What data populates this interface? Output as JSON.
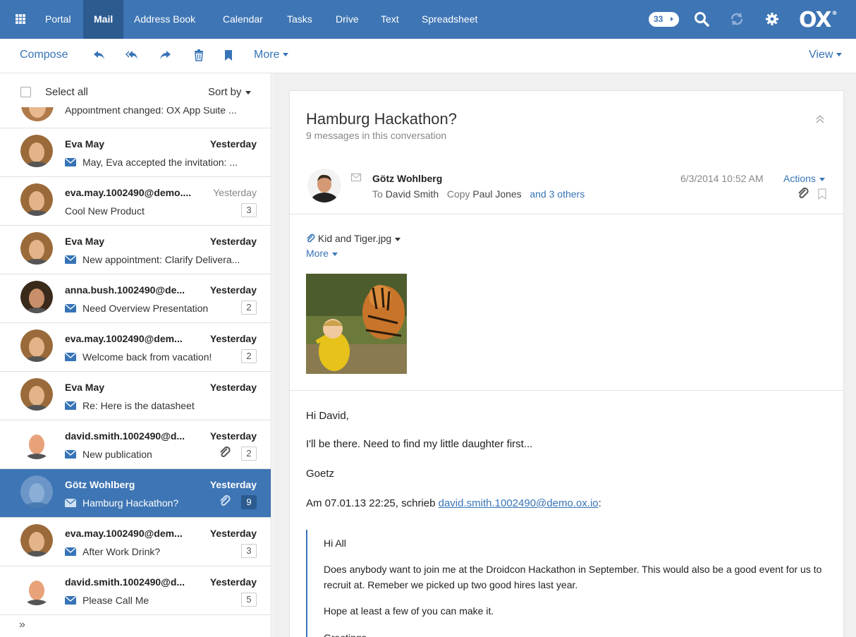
{
  "topbar": {
    "tabs": [
      {
        "label": "Portal",
        "active": false
      },
      {
        "label": "Mail",
        "active": true
      },
      {
        "label": "Address Book",
        "active": false
      },
      {
        "label": "Calendar",
        "active": false
      },
      {
        "label": "Tasks",
        "active": false
      },
      {
        "label": "Drive",
        "active": false
      },
      {
        "label": "Text",
        "active": false
      },
      {
        "label": "Spreadsheet",
        "active": false
      }
    ],
    "notification_count": "33",
    "logo": "OX",
    "accent_color": "#3e75b4",
    "icons": [
      "apps-grid-icon",
      "search-icon",
      "refresh-icon",
      "gear-icon"
    ]
  },
  "toolbar": {
    "compose": "Compose",
    "more": "More",
    "view": "View",
    "icons": [
      "reply-icon",
      "reply-all-icon",
      "forward-icon",
      "delete-icon",
      "flag-icon"
    ]
  },
  "list": {
    "select_all": "Select all",
    "sort_by": "Sort by",
    "partial_subject": "Appointment changed: OX App Suite ...",
    "items": [
      {
        "from": "Eva May",
        "date": "Yesterday",
        "subject": "May, Eva accepted the invitation: ...",
        "count": "",
        "unread": true,
        "attachment": false
      },
      {
        "from": "eva.may.1002490@demo....",
        "date": "Yesterday",
        "subject": "Cool New Product",
        "count": "3",
        "unread": false,
        "attachment": false
      },
      {
        "from": "Eva May",
        "date": "Yesterday",
        "subject": "New appointment: Clarify Delivera...",
        "count": "",
        "unread": true,
        "attachment": false
      },
      {
        "from": "anna.bush.1002490@de...",
        "date": "Yesterday",
        "subject": "Need Overview Presentation",
        "count": "2",
        "unread": true,
        "attachment": false
      },
      {
        "from": "eva.may.1002490@dem...",
        "date": "Yesterday",
        "subject": "Welcome back from vacation!",
        "count": "2",
        "unread": true,
        "attachment": false
      },
      {
        "from": "Eva May",
        "date": "Yesterday",
        "subject": "Re: Here is the datasheet",
        "count": "",
        "unread": true,
        "attachment": false
      },
      {
        "from": "david.smith.1002490@d...",
        "date": "Yesterday",
        "subject": "New publication",
        "count": "2",
        "unread": true,
        "attachment": true
      },
      {
        "from": "Götz Wohlberg",
        "date": "Yesterday",
        "subject": "Hamburg Hackathon?",
        "count": "9",
        "unread": true,
        "attachment": true,
        "selected": true
      },
      {
        "from": "eva.may.1002490@dem...",
        "date": "Yesterday",
        "subject": "After Work Drink?",
        "count": "3",
        "unread": true,
        "attachment": false
      },
      {
        "from": "david.smith.1002490@d...",
        "date": "Yesterday",
        "subject": "Please Call Me",
        "count": "5",
        "unread": true,
        "attachment": false
      }
    ],
    "expander": "»"
  },
  "detail": {
    "subject": "Hamburg Hackathon?",
    "conversation_count": "9 messages in this conversation",
    "sender": "Götz Wohlberg",
    "to_label": "To",
    "to": "David Smith",
    "copy_label": "Copy",
    "copy": "Paul Jones",
    "others": "and 3 others",
    "date": "6/3/2014 10:52 AM",
    "actions": "Actions",
    "attachment_name": "Kid and Tiger.jpg",
    "attachment_more": "More",
    "body": {
      "greeting": "Hi David,",
      "line1": "I'll be there. Need to find my little daughter first...",
      "signoff": "Goetz",
      "quote_intro": "Am 07.01.13 22:25, schrieb ",
      "quote_email": "david.smith.1002490@demo.ox.io",
      "quote_intro_end": ":",
      "quote": {
        "hi": "Hi All",
        "para": "Does anybody want to join me at the Droidcon Hackathon in September. This would also be a good event for us to recruit at. Remeber we picked up two good hires last year.",
        "hope": "Hope at least a few of you can make it.",
        "greetings": "Greetings"
      }
    }
  }
}
